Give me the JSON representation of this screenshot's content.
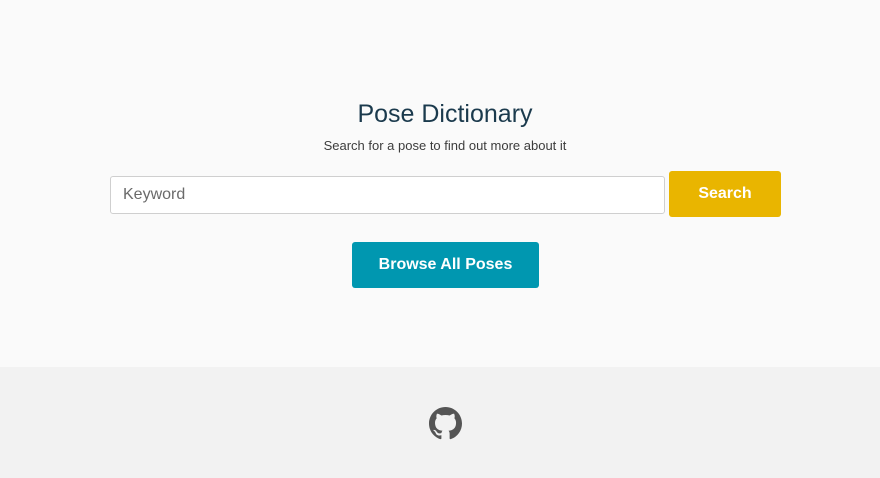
{
  "header": {
    "title": "Pose Dictionary",
    "subtitle": "Search for a pose to find out more about it"
  },
  "search": {
    "placeholder": "Keyword",
    "value": "",
    "button_label": "Search"
  },
  "browse": {
    "button_label": "Browse All Poses"
  },
  "footer": {
    "icon": "github-icon"
  },
  "colors": {
    "background": "#fafafa",
    "footer_background": "#f2f2f2",
    "title": "#1b3a4d",
    "search_button": "#e9b500",
    "browse_button": "#0097b0",
    "icon": "#555555"
  }
}
